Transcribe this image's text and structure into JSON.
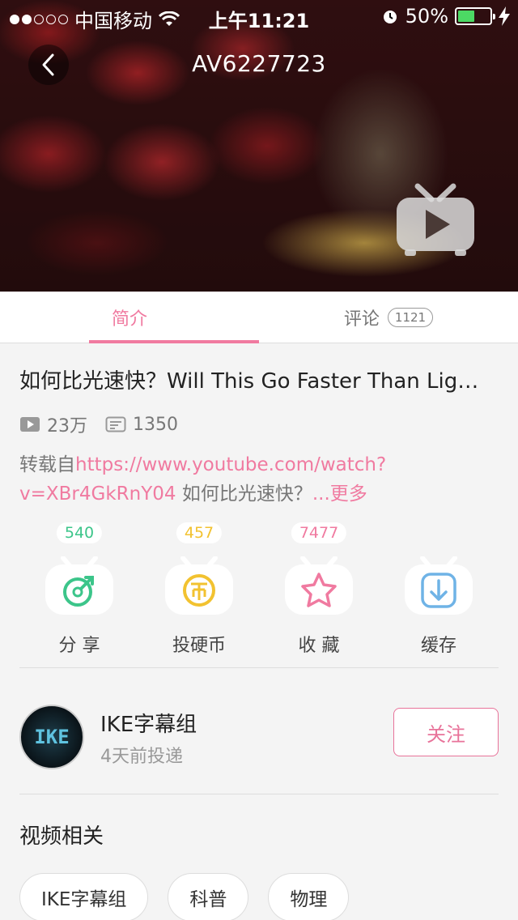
{
  "status_bar": {
    "carrier": "中国移动",
    "time": "上午11:21",
    "battery": "50%",
    "battery_color": "#4cd964",
    "signal_dots_filled": 2,
    "signal_dots_total": 5
  },
  "header": {
    "title": "AV6227723",
    "back_icon": "chevron-left-icon",
    "play_icon": "tv-play-icon"
  },
  "tabs": [
    {
      "label": "简介",
      "active": true
    },
    {
      "label": "评论",
      "count": "1121",
      "active": false
    }
  ],
  "video": {
    "title": "如何比光速快？Will This Go Faster Than Lig…",
    "views": "23万",
    "danmaku": "1350",
    "desc_prefix": "转载自",
    "desc_link": "https://www.youtube.com/watch?v=XBr4GkRnY04",
    "desc_suffix": " 如何比光速快？",
    "desc_more": "...更多"
  },
  "actions": [
    {
      "label": "分 享",
      "count": "540",
      "icon": "share-icon",
      "color": "#3cc58a"
    },
    {
      "label": "投硬币",
      "count": "457",
      "icon": "coin-icon",
      "color": "#f2c230"
    },
    {
      "label": "收 藏",
      "count": "7477",
      "icon": "star-icon",
      "color": "#f07aa0"
    },
    {
      "label": "缓存",
      "count": "",
      "icon": "download-icon",
      "color": "#6fb3e6"
    }
  ],
  "author": {
    "name": "IKE字幕组",
    "time": "4天前投递",
    "follow_label": "关注",
    "avatar_text": "IKE"
  },
  "related": {
    "title": "视频相关",
    "tags": [
      "IKE字幕组",
      "科普",
      "物理"
    ]
  },
  "accent_color": "#f07aa0"
}
